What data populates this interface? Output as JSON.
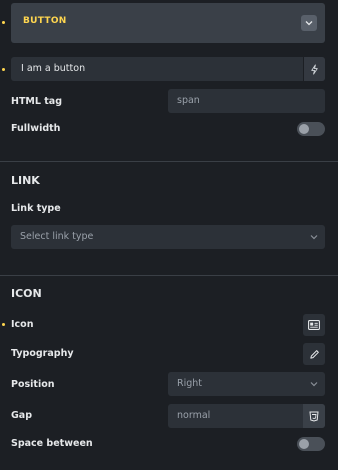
{
  "header": {
    "title": "BUTTON"
  },
  "text_field": {
    "value": "I am a button"
  },
  "html_tag": {
    "label": "HTML tag",
    "value": "span"
  },
  "fullwidth": {
    "label": "Fullwidth"
  },
  "link_section": {
    "title": "LINK",
    "link_type_label": "Link type",
    "link_type_placeholder": "Select link type"
  },
  "icon_section": {
    "title": "ICON",
    "icon_label": "Icon",
    "typography_label": "Typography",
    "position_label": "Position",
    "position_value": "Right",
    "gap_label": "Gap",
    "gap_value": "normal",
    "space_between_label": "Space between"
  },
  "colors": {
    "accent": "#ffd64f",
    "background": "#1c1f24",
    "field": "#2c3138"
  }
}
